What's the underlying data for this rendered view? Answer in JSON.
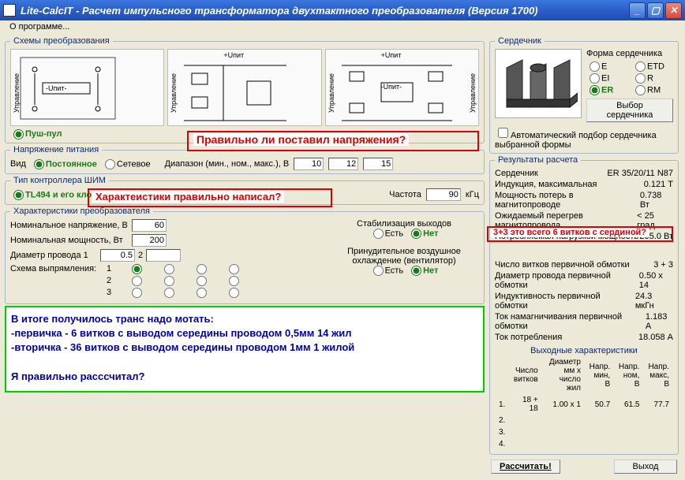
{
  "window": {
    "title": "Lite-CalcIT - Расчет импульсного трансформатора двухтактного преобразователя (Версия 1700)"
  },
  "menu": {
    "about": "О программе..."
  },
  "schemes": {
    "legend": "Схемы преобразования",
    "pushpull": "Пуш-пул",
    "ctrl": "Управление",
    "upit": "-Uпит-",
    "upit_plus": "+Uпит"
  },
  "supply": {
    "legend": "Напряжение питания",
    "kind": "Вид",
    "dc": "Постоянное",
    "ac": "Сетевое",
    "range_label": "Диапазон (мин., ном., макс.), В",
    "min": "10",
    "nom": "12",
    "max": "15"
  },
  "pwm": {
    "legend": "Тип контроллера ШИМ",
    "tl494": "TL494 и его клоны",
    "freq_label": "Частота",
    "freq": "90",
    "freq_unit": "кГц"
  },
  "conv": {
    "legend": "Характеристики преобразователя",
    "vnom_label": "Номинальное напряжение, В",
    "vnom": "60",
    "pnom_label": "Номинальная мощность, Вт",
    "pnom": "200",
    "wire_label": "Диаметр провода 1",
    "wire": "0.5",
    "wire2_label": "2",
    "rect_label": "Схема выпрямления:",
    "stab_label": "Стабилизация выходов",
    "yes": "Есть",
    "no": "Нет",
    "cool_label": "Принудительное воздушное охлаждение (вентилятор)"
  },
  "notes": {
    "q1": "Правильно ли поставил напряжения?",
    "q2": "Характеистики правильно написал?",
    "q3": "3+3 это  всего 6 витков с сердиной?",
    "green": "В итоге получилось транс надо мотать:\n-первичка - 6 витков  с выводом середины проводом 0,5мм 14 жил\n-вторичка -  36 витков с выводом середины проводом 1мм 1 жилой\n\nЯ правильно расссчитал?"
  },
  "core": {
    "legend": "Сердечник",
    "shape_label": "Форма сердечника",
    "shapes": [
      "E",
      "ETD",
      "EI",
      "R",
      "ER",
      "RM"
    ],
    "shape_sel": "ER",
    "choose_btn": "Выбор сердечника",
    "auto": "Автоматический подбор сердечника выбранной формы"
  },
  "results": {
    "legend": "Результаты расчета",
    "rows": [
      [
        "Сердечник",
        "ER 35/20/11 N87"
      ],
      [
        "Индукция, максимальная",
        "0.121 Т"
      ],
      [
        "Мощность потерь в магнитопроводе",
        "0.738 Вт"
      ],
      [
        "Ожидаемый перегрев магнитопровода",
        "< 25 град."
      ],
      [
        "Потребляемая нагрузкой мощность",
        "205.0 Вт"
      ]
    ],
    "rows2": [
      [
        "Число витков первичной обмотки",
        "3 + 3"
      ],
      [
        "Диаметр провода первичной обмотки",
        "0.50 x 14"
      ],
      [
        "Индуктивность первичной обмотки",
        "24.3 мкГн"
      ],
      [
        "Ток намагничивания первичной обмотки",
        "1.183 А"
      ],
      [
        "Ток потребления",
        "18.058 А"
      ]
    ],
    "out_legend": "Выходные характеристики",
    "out_headers": [
      "",
      "Число витков",
      "Диаметр мм х число жил",
      "Напр. мин, В",
      "Напр. ном, В",
      "Напр. макс, В"
    ],
    "out_rows": [
      [
        "1.",
        "18 + 18",
        "1.00 x 1",
        "50.7",
        "61.5",
        "77.7"
      ],
      [
        "2.",
        "",
        "",
        "",
        "",
        ""
      ],
      [
        "3.",
        "",
        "",
        "",
        "",
        ""
      ],
      [
        "4.",
        "",
        "",
        "",
        "",
        ""
      ]
    ]
  },
  "buttons": {
    "calc": "Рассчитать!",
    "exit": "Выход"
  }
}
